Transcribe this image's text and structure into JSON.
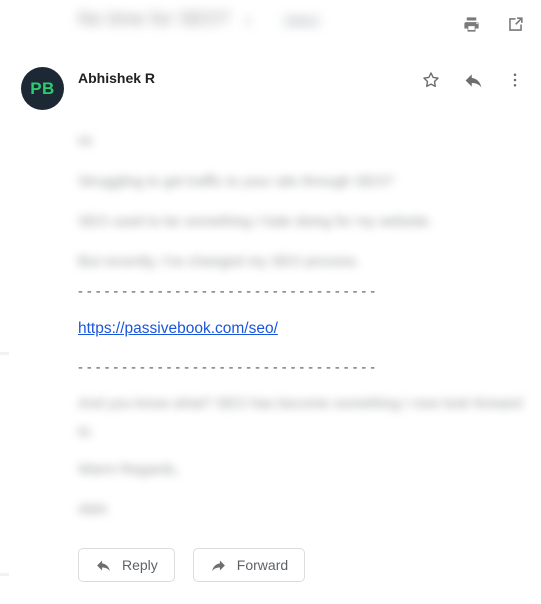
{
  "window": {
    "background": "#ffffff",
    "link_color": "#1a56db",
    "avatar_bg": "#1c2833",
    "avatar_fg": "#2ecc71",
    "icon_color": "#7a7a7a"
  },
  "header": {
    "subject": "No time for SEO?",
    "thread_count": "2",
    "label": "Inbox",
    "print_icon": "print-icon",
    "open_in_new_icon": "open-in-new-window-icon"
  },
  "sender": {
    "avatar_initials": "PB",
    "name": "Abhishek R",
    "star_icon": "star-outline-icon",
    "reply_icon": "reply-arrow-icon",
    "more_icon": "more-vertical-icon"
  },
  "body": {
    "greeting": "Hi",
    "lines": [
      "Struggling to get traffic to your site through SEO?",
      "SEO used to be something I hate doing for my website.",
      "But recently, I've changed my SEO process."
    ],
    "separator": "- - - - - - - - - - - - - - - - - - - - - - - - - - - - - - - - - -",
    "link": "https://passivebook.com/seo/",
    "paragraph": "And you know what? SEO has become something I now look forward to.",
    "signoff": "Warm Regards,",
    "signature": "Abhi"
  },
  "footer": {
    "reply_label": "Reply",
    "reply_icon": "reply-arrow-icon",
    "forward_label": "Forward",
    "forward_icon": "forward-arrow-icon"
  }
}
